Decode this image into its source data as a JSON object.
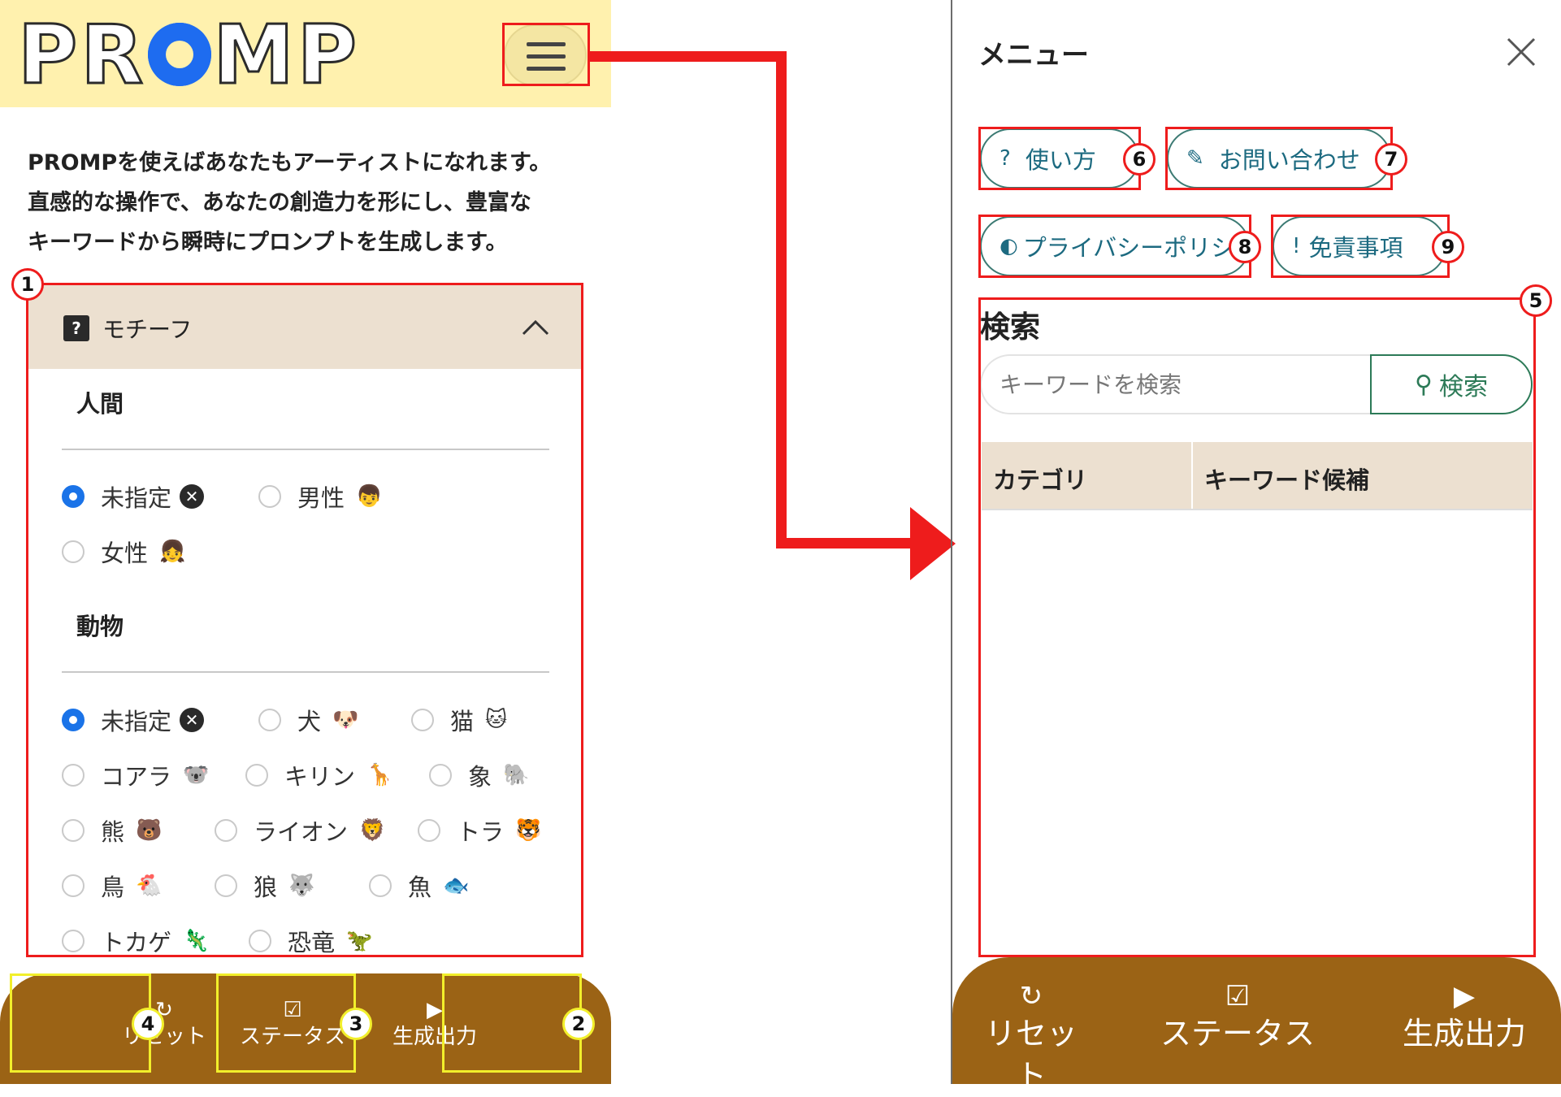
{
  "left": {
    "logo": {
      "p1": "PR",
      "p2": "MP"
    },
    "intro": [
      "PROMPを使えばあなたもアーティストになれます。",
      "直感的な操作で、あなたの創造力を形にし、豊富な",
      "キーワードから瞬時にプロンプトを生成します。"
    ],
    "motif": {
      "help_icon": "?",
      "title": "モチーフ",
      "sections": [
        {
          "title": "人間",
          "options": [
            {
              "label": "未指定",
              "emoji": "✕",
              "checked": true
            },
            {
              "label": "男性",
              "emoji": "👦",
              "checked": false
            },
            {
              "label": "女性",
              "emoji": "👧",
              "checked": false
            }
          ]
        },
        {
          "title": "動物",
          "options": [
            {
              "label": "未指定",
              "emoji": "✕",
              "checked": true
            },
            {
              "label": "犬",
              "emoji": "🐶",
              "checked": false
            },
            {
              "label": "猫",
              "emoji": "🐱",
              "checked": false
            },
            {
              "label": "コアラ",
              "emoji": "🐨",
              "checked": false
            },
            {
              "label": "キリン",
              "emoji": "🦒",
              "checked": false
            },
            {
              "label": "象",
              "emoji": "🐘",
              "checked": false
            },
            {
              "label": "熊",
              "emoji": "🐻",
              "checked": false
            },
            {
              "label": "ライオン",
              "emoji": "🦁",
              "checked": false
            },
            {
              "label": "トラ",
              "emoji": "🐯",
              "checked": false
            },
            {
              "label": "鳥",
              "emoji": "🐔",
              "checked": false
            },
            {
              "label": "狼",
              "emoji": "🐺",
              "checked": false
            },
            {
              "label": "魚",
              "emoji": "🐟",
              "checked": false
            },
            {
              "label": "トカゲ",
              "emoji": "🦎",
              "checked": false
            },
            {
              "label": "恐竜",
              "emoji": "🦖",
              "checked": false
            }
          ]
        }
      ]
    },
    "bottom_bar": {
      "reset_icon": "↻",
      "reset": "リセット",
      "status_icon": "☑",
      "status": "ステータス",
      "generate_icon": "▶",
      "generate": "生成出力"
    }
  },
  "right": {
    "menu_title": "メニュー",
    "close_icon": "✕",
    "links": {
      "howto": {
        "icon": "?",
        "label": "使い方"
      },
      "contact": {
        "icon": "✎",
        "label": "お問い合わせ"
      },
      "privacy": {
        "icon": "◐",
        "label": "プライバシーポリシー"
      },
      "disclaimer": {
        "icon": "!",
        "label": "免責事項"
      }
    },
    "search": {
      "title": "検索",
      "placeholder": "キーワードを検索",
      "button_icon": "⚲",
      "button": "検索"
    },
    "table": {
      "columns": [
        "カテゴリ",
        "キーワード候補"
      ]
    },
    "bottom_bar": {
      "reset_icon": "↻",
      "reset": "リセット",
      "status_icon": "☑",
      "status": "ステータス",
      "generate_icon": "▶",
      "generate": "生成出力"
    }
  },
  "annotations": [
    "1",
    "2",
    "3",
    "4",
    "5",
    "6",
    "7",
    "8",
    "9"
  ],
  "colors": {
    "header_bg": "#fff1ae",
    "bar_bg": "#9b6315",
    "accent_blue": "#1a73e8",
    "annotation_red": "#ee1c1c",
    "annotation_yellow": "#f2ef2b",
    "link_teal": "#1c6a80"
  }
}
